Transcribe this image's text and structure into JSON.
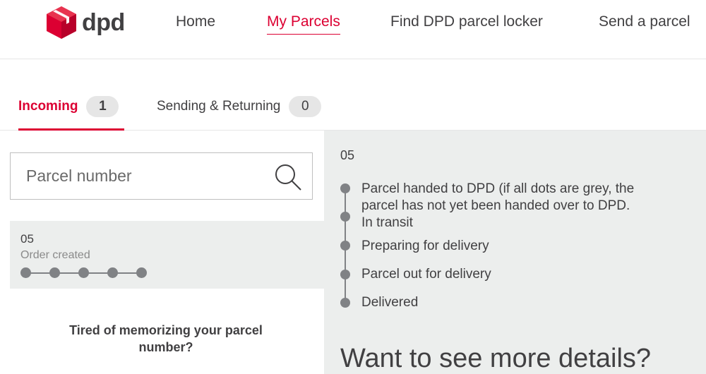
{
  "brand": {
    "name": "dpd",
    "accent": "#dc0032"
  },
  "nav": {
    "home": "Home",
    "my_parcels": "My Parcels",
    "find_locker": "Find DPD parcel locker",
    "send_parcel": "Send a parcel"
  },
  "tabs": {
    "incoming": {
      "label": "Incoming",
      "count": "1"
    },
    "sending": {
      "label": "Sending & Returning",
      "count": "0"
    }
  },
  "search": {
    "placeholder": "Parcel number",
    "icon": "search-icon"
  },
  "parcel_card": {
    "id": "05",
    "status": "Order created",
    "progress_steps_total": 5
  },
  "promo": {
    "text": "Tired of memorizing your parcel number?"
  },
  "details": {
    "id": "05",
    "timeline": [
      "Parcel handed to DPD (if all dots are grey, the parcel has not yet been handed over to DPD.",
      "In transit",
      "Preparing for delivery",
      "Parcel out for delivery",
      "Delivered"
    ],
    "more_heading": "Want to see more details?"
  }
}
